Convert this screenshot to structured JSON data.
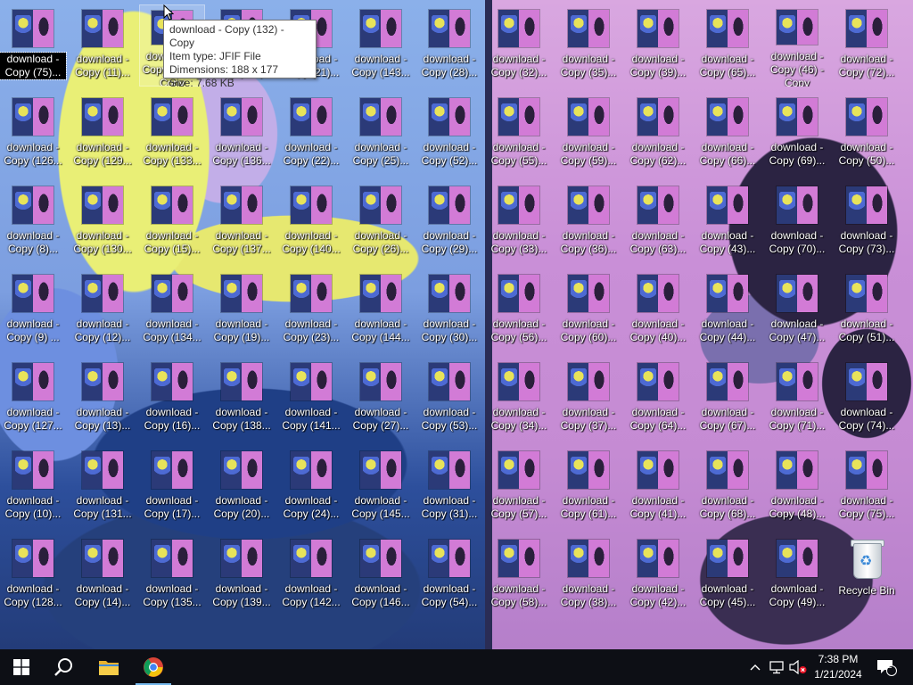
{
  "desktop": {
    "grid": [
      [
        "download - Copy (75)...",
        "download - Copy (11)...",
        "download - Copy (132) - Copy",
        "download - Copy (134)...",
        "download - Copy (21)...",
        "download - Copy (143...",
        "download - Copy (28)...",
        "download - Copy (32)...",
        "download - Copy (35)...",
        "download - Copy (39)...",
        "download - Copy (65)...",
        "download - Copy (46) - Copy",
        "download - Copy (72)..."
      ],
      [
        "download - Copy (126...",
        "download - Copy (129...",
        "download - Copy (133...",
        "download - Copy (136...",
        "download - Copy (22)...",
        "download - Copy (25)...",
        "download - Copy (52)...",
        "download - Copy (55)...",
        "download - Copy (59)...",
        "download - Copy (62)...",
        "download - Copy (66)...",
        "download - Copy (69)...",
        "download - Copy (50)..."
      ],
      [
        "download - Copy (8)...",
        "download - Copy (130...",
        "download - Copy (15)...",
        "download - Copy (137...",
        "download - Copy (140...",
        "download - Copy (26)...",
        "download - Copy (29)...",
        "download - Copy (33)...",
        "download - Copy (36)...",
        "download - Copy (63)...",
        "download - Copy (43)...",
        "download - Copy (70)...",
        "download - Copy (73)..."
      ],
      [
        "download - Copy (9) ...",
        "download - Copy (12)...",
        "download - Copy (134...",
        "download - Copy (19)...",
        "download - Copy (23)...",
        "download - Copy (144...",
        "download - Copy (30)...",
        "download - Copy (56)...",
        "download - Copy (60)...",
        "download - Copy (40)...",
        "download - Copy (44)...",
        "download - Copy (47)...",
        "download - Copy (51)..."
      ],
      [
        "download - Copy (127...",
        "download - Copy (13)...",
        "download - Copy (16)...",
        "download - Copy (138...",
        "download - Copy (141...",
        "download - Copy (27)...",
        "download - Copy (53)...",
        "download - Copy (34)...",
        "download - Copy (37)...",
        "download - Copy (64)...",
        "download - Copy (67)...",
        "download - Copy (71)...",
        "download - Copy (74)..."
      ],
      [
        "download - Copy (10)...",
        "download - Copy (131...",
        "download - Copy (17)...",
        "download - Copy (20)...",
        "download - Copy (24)...",
        "download - Copy (145...",
        "download - Copy (31)...",
        "download - Copy (57)...",
        "download - Copy (61)...",
        "download - Copy (41)...",
        "download - Copy (68)...",
        "download - Copy (48)...",
        "download - Copy (75)..."
      ],
      [
        "download - Copy (128...",
        "download - Copy (14)...",
        "download - Copy (135...",
        "download - Copy (139...",
        "download - Copy (142...",
        "download - Copy (146...",
        "download - Copy (54)...",
        "download - Copy (58)...",
        "download - Copy (38)...",
        "download - Copy (42)...",
        "download - Copy (45)...",
        "download - Copy (49)...",
        "Recycle Bin"
      ]
    ],
    "hovered_icon": "download - Copy (132) - Copy",
    "recycle_bin_label": "Recycle Bin"
  },
  "tooltip": {
    "name": "download - Copy (132) - Copy",
    "type": "Item type: JFIF File",
    "dimensions": "Dimensions: 188 x 177",
    "size": "Size: 7.68 KB"
  },
  "taskbar": {
    "start_icon": "windows-icon",
    "search_icon": "search-icon",
    "pinned": [
      "file-explorer-icon",
      "chrome-icon"
    ],
    "tray": [
      "chevron-up-icon",
      "network-icon",
      "volume-muted-icon"
    ],
    "time": "7:38 PM",
    "date": "1/21/2024",
    "notification_count": "2"
  },
  "colors": {
    "taskbar_bg": "#0d0f15",
    "active_indicator": "#76b9ed"
  }
}
